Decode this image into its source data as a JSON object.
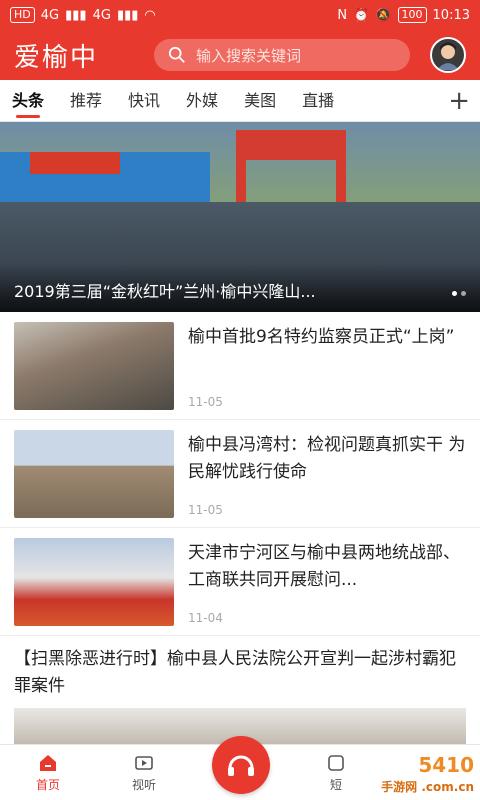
{
  "status_bar": {
    "carrier_left": "HD",
    "signal_a": "4G",
    "signal_b": "4G",
    "battery": "100",
    "time": "10:13"
  },
  "header": {
    "logo": "爱榆中",
    "search_placeholder": "输入搜索关键词"
  },
  "tabs": [
    {
      "label": "头条"
    },
    {
      "label": "推荐"
    },
    {
      "label": "快讯"
    },
    {
      "label": "外媒"
    },
    {
      "label": "美图"
    },
    {
      "label": "直播"
    }
  ],
  "banner": {
    "caption": "2019第三届“金秋红叶”兰州·榆中兴隆山..."
  },
  "news": [
    {
      "title": "榆中首批9名特约监察员正式“上岗”",
      "date": "11-05"
    },
    {
      "title": "榆中县冯湾村：检视问题真抓实干 为民解忧践行使命",
      "date": "11-05"
    },
    {
      "title": "天津市宁河区与榆中县两地统战部、工商联共同开展慰问...",
      "date": "11-04"
    }
  ],
  "wide_news": {
    "title": "【扫黑除恶进行时】榆中县人民法院公开宣判一起涉村霸犯罪案件"
  },
  "bottom_nav": [
    {
      "label": "首页"
    },
    {
      "label": "视听"
    },
    {
      "label": ""
    },
    {
      "label": "短"
    }
  ],
  "watermark": {
    "big": "5410",
    "small": "手游网 .com.cn"
  },
  "colors": {
    "brand": "#e8392e"
  }
}
